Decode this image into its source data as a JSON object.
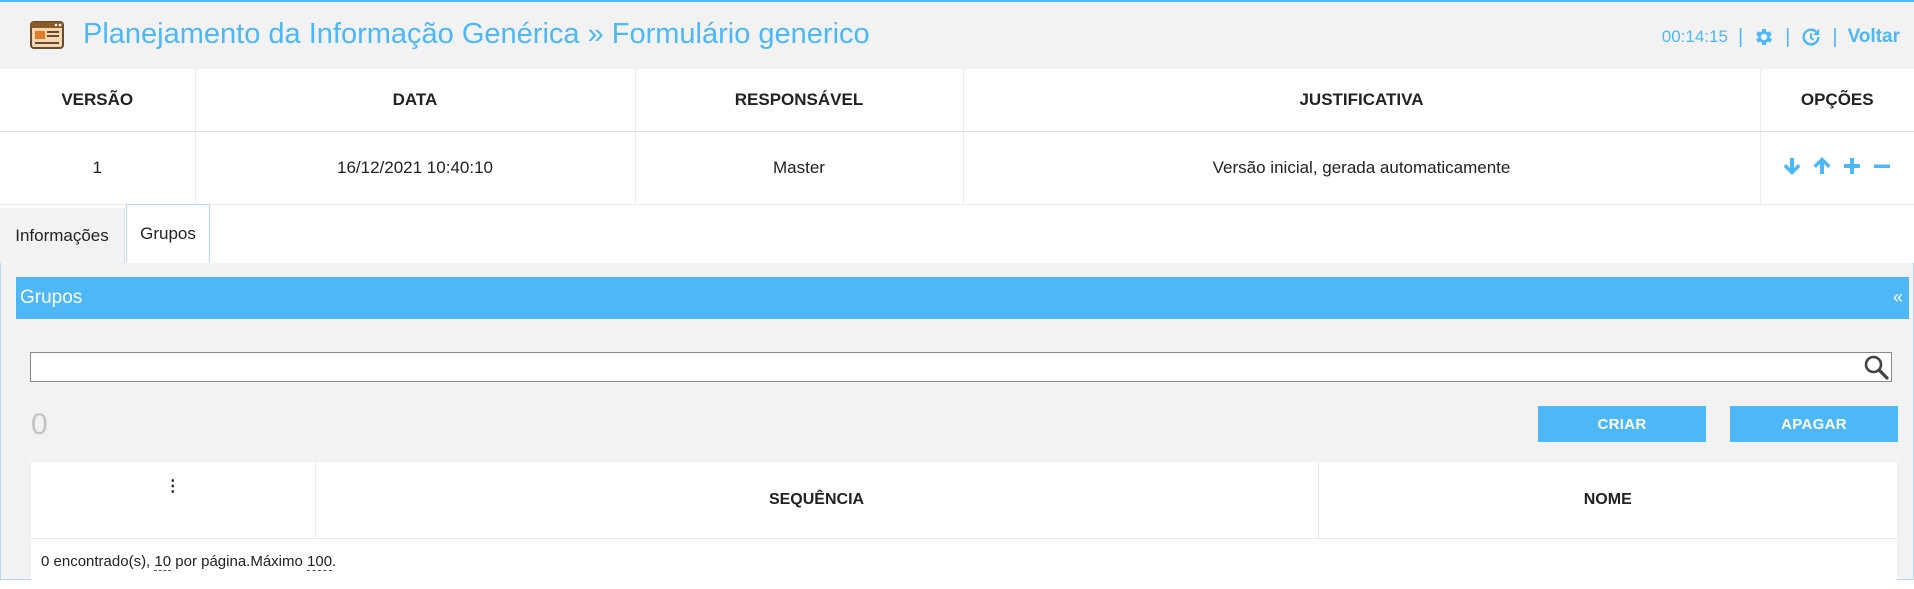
{
  "header": {
    "title": "Planejamento da Informação Genérica » Formulário generico",
    "timer": "00:14:15",
    "back_label": "Voltar",
    "icons": [
      "app-window-icon",
      "gear-icon",
      "history-icon"
    ]
  },
  "versions": {
    "columns": [
      "VERSÃO",
      "DATA",
      "RESPONSÁVEL",
      "JUSTIFICATIVA",
      "OPÇÕES"
    ],
    "rows": [
      {
        "version": "1",
        "date": "16/12/2021 10:40:10",
        "responsible": "Master",
        "justification": "Versão inicial, gerada automaticamente",
        "options": [
          "arrow-down-icon",
          "arrow-up-icon",
          "plus-icon",
          "minus-icon"
        ]
      }
    ]
  },
  "tabs": [
    {
      "label": "Informações",
      "active": false
    },
    {
      "label": "Grupos",
      "active": true
    }
  ],
  "panel": {
    "title": "Grupos",
    "collapse_label": "«",
    "search": {
      "value": "",
      "placeholder": ""
    },
    "count": "0",
    "create_label": "CRIAR",
    "delete_label": "APAGAR",
    "table": {
      "menu_glyph": "⋮",
      "columns": [
        "SEQUÊNCIA",
        "NOME"
      ],
      "footer": {
        "found": "0 encontrado(s),",
        "per_page": "10",
        "per_page_label": "por página.Máximo",
        "max": "100",
        "end": "."
      }
    }
  },
  "colors": {
    "accent": "#4db8f5",
    "header_bg": "#f2f2f2",
    "count": "#c4c4c4"
  }
}
